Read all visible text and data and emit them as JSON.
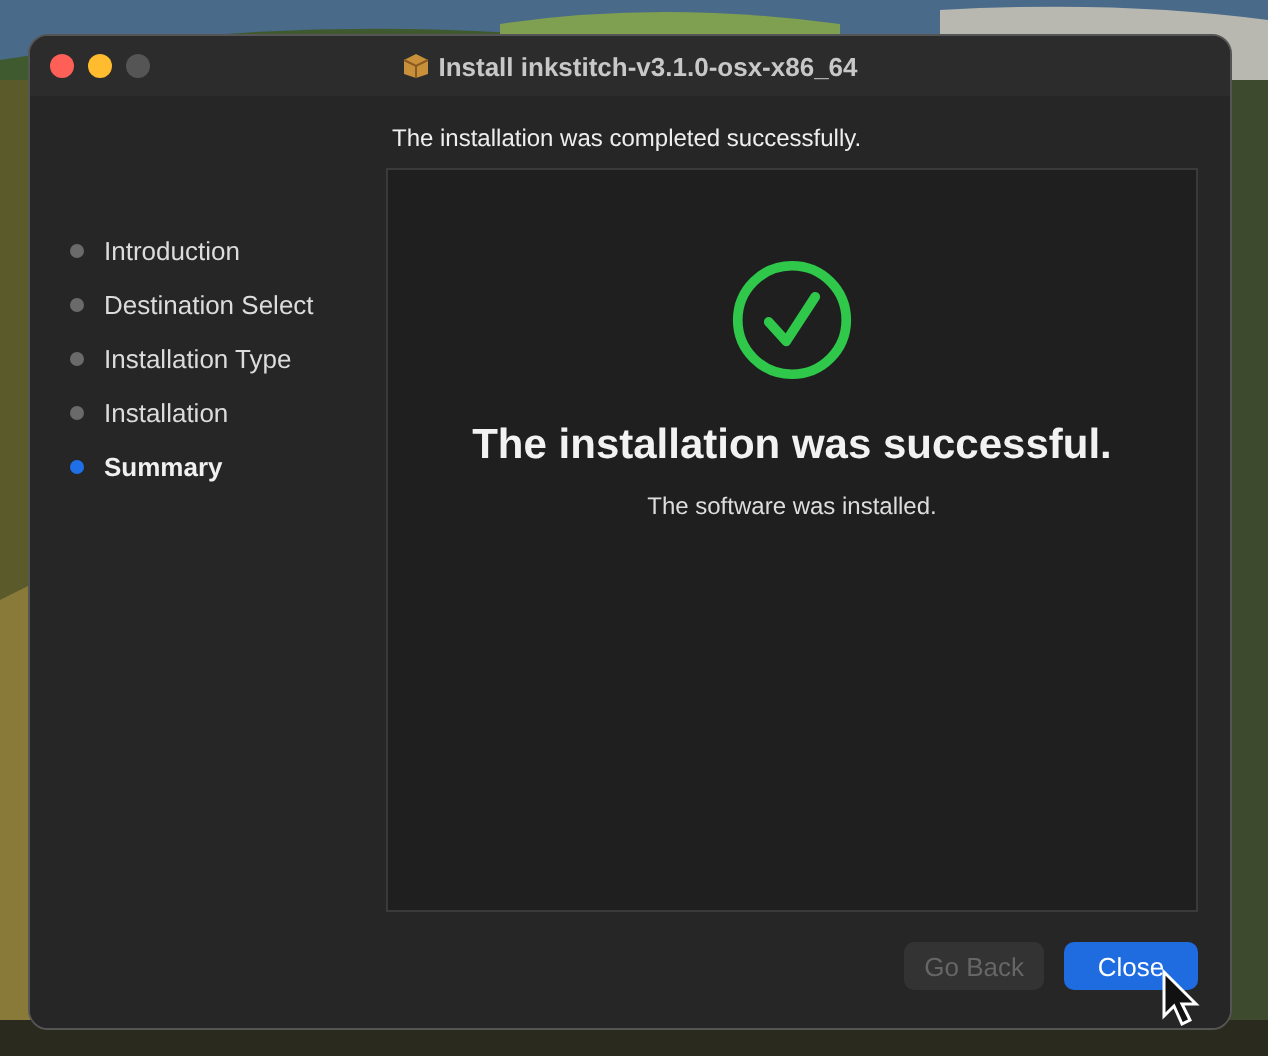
{
  "window": {
    "title": "Install inkstitch-v3.1.0-osx-x86_64"
  },
  "sidebar": {
    "items": [
      {
        "label": "Introduction",
        "selected": false
      },
      {
        "label": "Destination Select",
        "selected": false
      },
      {
        "label": "Installation Type",
        "selected": false
      },
      {
        "label": "Installation",
        "selected": false
      },
      {
        "label": "Summary",
        "selected": true
      }
    ]
  },
  "header": "The installation was completed successfully.",
  "summary": {
    "heading": "The installation was successful.",
    "message": "The software was installed."
  },
  "buttons": [
    {
      "label": "Go Back",
      "kind": "secondary",
      "disabled": true
    },
    {
      "label": "Close",
      "kind": "primary",
      "disabled": false
    }
  ]
}
